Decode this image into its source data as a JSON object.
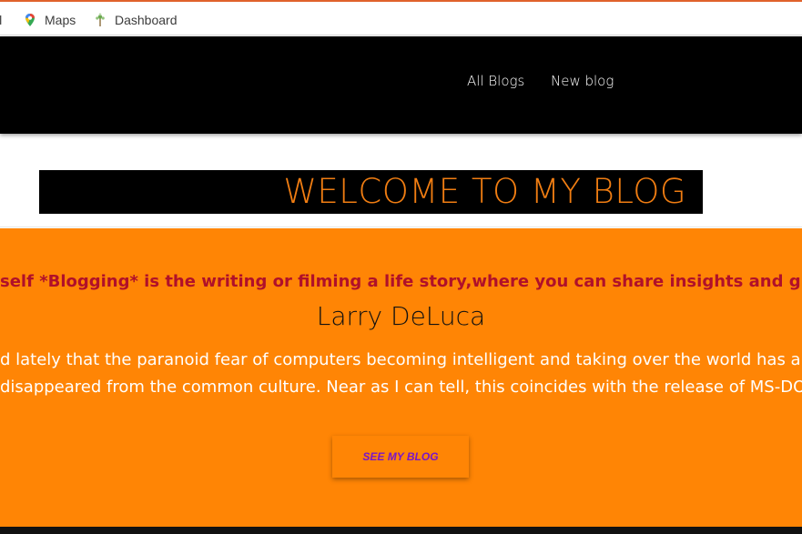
{
  "bookmarks_bar": {
    "items": [
      {
        "label": "il",
        "icon": "bookmark-truncated"
      },
      {
        "label": "Maps",
        "icon": "maps-pin-icon"
      },
      {
        "label": "Dashboard",
        "icon": "dashboard-icon"
      }
    ],
    "accent_color": "#e0622c"
  },
  "navbar": {
    "links": [
      "All Blogs",
      "New blog"
    ],
    "background": "#000000"
  },
  "welcome": {
    "title": "WELCOME TO MY BLOG",
    "title_color": "#f07d12"
  },
  "hero": {
    "background": "#ff8505",
    "tagline": "self *Blogging* is the writing or filming a life story,where you can share insights and give a platform",
    "author": "Larry DeLuca",
    "quote_lines": [
      "d lately that the paranoid fear of computers becoming intelligent and taking over the world has almo",
      "disappeared from the common culture. Near as I can tell, this coincides with the release of MS-DOS."
    ],
    "cta_label": "SEE MY BLOG"
  }
}
